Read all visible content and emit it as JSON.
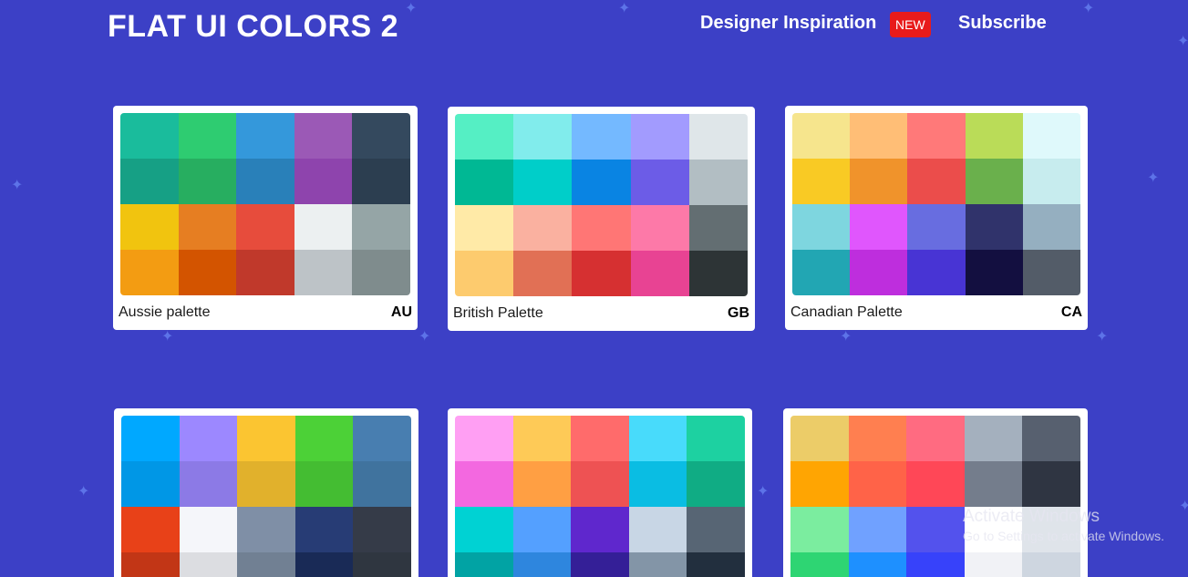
{
  "header": {
    "brand": "FLAT UI COLORS 2",
    "nav": {
      "inspiration_label": "Designer Inspiration",
      "new_badge": "NEW",
      "subscribe_label": "Subscribe"
    }
  },
  "colors": {
    "background": "#3c40c6",
    "badge": "#e81b1b",
    "sparkle": "#5d73e8"
  },
  "icons": {
    "sparkle": "four-point-star"
  },
  "palettes": [
    {
      "name": "Aussie palette",
      "code": "AU",
      "swatches": [
        "#1abc9c",
        "#2ecc71",
        "#3498db",
        "#9b59b6",
        "#34495e",
        "#16a085",
        "#27ae60",
        "#2980b9",
        "#8e44ad",
        "#2c3e50",
        "#f1c40f",
        "#e67e22",
        "#e74c3c",
        "#ecf0f1",
        "#95a5a6",
        "#f39c12",
        "#d35400",
        "#c0392b",
        "#bdc3c7",
        "#7f8c8d"
      ]
    },
    {
      "name": "British Palette",
      "code": "GB",
      "swatches": [
        "#55efc4",
        "#81ecec",
        "#74b9ff",
        "#a29bfe",
        "#dfe6e9",
        "#00b894",
        "#00cec9",
        "#0984e3",
        "#6c5ce7",
        "#b2bec3",
        "#ffeaa7",
        "#fab1a0",
        "#ff7675",
        "#fd79a8",
        "#636e72",
        "#fdcb6e",
        "#e17055",
        "#d63031",
        "#e84393",
        "#2d3436"
      ]
    },
    {
      "name": "Canadian Palette",
      "code": "CA",
      "swatches": [
        "#f6e58d",
        "#ffbe76",
        "#ff7979",
        "#badc58",
        "#dff9fb",
        "#f9ca24",
        "#f0932b",
        "#eb4d4b",
        "#6ab04c",
        "#c7ecee",
        "#7ed6df",
        "#e056fd",
        "#686de0",
        "#30336b",
        "#95afc0",
        "#22a6b3",
        "#be2edd",
        "#4834d4",
        "#130f40",
        "#535c68"
      ]
    },
    {
      "name": "",
      "code": "",
      "swatches": [
        "#00a8ff",
        "#9c88ff",
        "#fbc531",
        "#4cd137",
        "#487eb0",
        "#0097e6",
        "#8c7ae6",
        "#e1b12c",
        "#44bd32",
        "#40739e",
        "#e84118",
        "#f5f6fa",
        "#7f8fa6",
        "#273c75",
        "#353b48",
        "#c23616",
        "#dcdde1",
        "#718093",
        "#192a56",
        "#2f3640"
      ]
    },
    {
      "name": "",
      "code": "",
      "swatches": [
        "#ff9ff3",
        "#feca57",
        "#ff6b6b",
        "#48dbfb",
        "#1dd1a1",
        "#f368e0",
        "#ff9f43",
        "#ee5253",
        "#0abde3",
        "#10ac84",
        "#00d2d3",
        "#54a0ff",
        "#5f27cd",
        "#c8d6e5",
        "#576574",
        "#01a3a4",
        "#2e86de",
        "#341f97",
        "#8395a7",
        "#222f3e"
      ]
    },
    {
      "name": "",
      "code": "",
      "swatches": [
        "#eccc68",
        "#ff7f50",
        "#ff6b81",
        "#a4b0be",
        "#57606f",
        "#ffa502",
        "#ff6348",
        "#ff4757",
        "#747d8c",
        "#2f3542",
        "#7bed9f",
        "#70a1ff",
        "#5352ed",
        "#ffffff",
        "#dfe4ea",
        "#2ed573",
        "#1e90ff",
        "#3742fa",
        "#f1f2f6",
        "#ced6e0"
      ]
    }
  ],
  "watermark": {
    "title": "Activate Windows",
    "subtitle": "Go to Settings to activate Windows."
  }
}
